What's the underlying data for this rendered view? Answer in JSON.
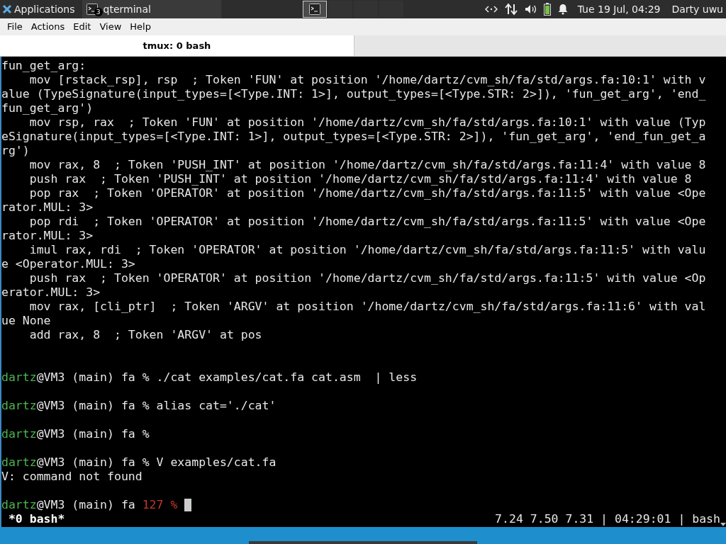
{
  "panel": {
    "apps_label": "Applications",
    "task": {
      "label": "qterminal",
      "badge": "3"
    },
    "clock": "Tue 19 Jul, 04:29",
    "user": "Darty uwu"
  },
  "menu": [
    {
      "label": "File"
    },
    {
      "label": "Actions"
    },
    {
      "label": "Edit"
    },
    {
      "label": "View"
    },
    {
      "label": "Help"
    }
  ],
  "tabs": [
    {
      "label": "tmux: 0 bash",
      "selected": true
    }
  ],
  "terminal": {
    "lines": [
      {
        "kind": "output",
        "text": "fun_get_arg:"
      },
      {
        "kind": "output",
        "text": "    mov [rstack_rsp], rsp  ; Token 'FUN' at position '/home/dartz/cvm_sh/fa/std/args.fa:10:1' with v"
      },
      {
        "kind": "output",
        "text": "alue (TypeSignature(input_types=[<Type.INT: 1>], output_types=[<Type.STR: 2>]), 'fun_get_arg', 'end_"
      },
      {
        "kind": "output",
        "text": "fun_get_arg')"
      },
      {
        "kind": "output",
        "text": "    mov rsp, rax  ; Token 'FUN' at position '/home/dartz/cvm_sh/fa/std/args.fa:10:1' with value (Typ"
      },
      {
        "kind": "output",
        "text": "eSignature(input_types=[<Type.INT: 1>], output_types=[<Type.STR: 2>]), 'fun_get_arg', 'end_fun_get_a"
      },
      {
        "kind": "output",
        "text": "rg')"
      },
      {
        "kind": "output",
        "text": "    mov rax, 8  ; Token 'PUSH_INT' at position '/home/dartz/cvm_sh/fa/std/args.fa:11:4' with value 8"
      },
      {
        "kind": "output",
        "text": "    push rax  ; Token 'PUSH_INT' at position '/home/dartz/cvm_sh/fa/std/args.fa:11:4' with value 8"
      },
      {
        "kind": "output",
        "text": "    pop rax  ; Token 'OPERATOR' at position '/home/dartz/cvm_sh/fa/std/args.fa:11:5' with value <Ope"
      },
      {
        "kind": "output",
        "text": "rator.MUL: 3>"
      },
      {
        "kind": "output",
        "text": "    pop rdi  ; Token 'OPERATOR' at position '/home/dartz/cvm_sh/fa/std/args.fa:11:5' with value <Ope"
      },
      {
        "kind": "output",
        "text": "rator.MUL: 3>"
      },
      {
        "kind": "output",
        "text": "    imul rax, rdi  ; Token 'OPERATOR' at position '/home/dartz/cvm_sh/fa/std/args.fa:11:5' with valu"
      },
      {
        "kind": "output",
        "text": "e <Operator.MUL: 3>"
      },
      {
        "kind": "output",
        "text": "    push rax  ; Token 'OPERATOR' at position '/home/dartz/cvm_sh/fa/std/args.fa:11:5' with value <Op"
      },
      {
        "kind": "output",
        "text": "erator.MUL: 3>"
      },
      {
        "kind": "output",
        "text": "    mov rax, [cli_ptr]  ; Token 'ARGV' at position '/home/dartz/cvm_sh/fa/std/args.fa:11:6' with val"
      },
      {
        "kind": "output",
        "text": "ue None"
      },
      {
        "kind": "output",
        "text": "    add rax, 8  ; Token 'ARGV' at pos"
      },
      {
        "kind": "blank"
      },
      {
        "kind": "blank"
      },
      {
        "kind": "prompt",
        "user": "dartz",
        "host": "@VM3 (main) fa",
        "symbol": "%",
        "command": "./cat examples/cat.fa cat.asm  | less"
      },
      {
        "kind": "blank"
      },
      {
        "kind": "prompt",
        "user": "dartz",
        "host": "@VM3 (main) fa",
        "symbol": "%",
        "command": "alias cat='./cat'"
      },
      {
        "kind": "blank"
      },
      {
        "kind": "prompt",
        "user": "dartz",
        "host": "@VM3 (main) fa",
        "symbol": "%"
      },
      {
        "kind": "blank"
      },
      {
        "kind": "prompt",
        "user": "dartz",
        "host": "@VM3 (main) fa",
        "symbol": "%",
        "command": "V examples/cat.fa"
      },
      {
        "kind": "output",
        "text": "V: command not found"
      },
      {
        "kind": "blank"
      },
      {
        "kind": "prompt",
        "user": "dartz",
        "host": "@VM3 (main) fa",
        "status": "127",
        "symbol": "%",
        "cursor": true
      }
    ],
    "status_left": "*0 bash*",
    "status_right": "7.24 7.50 7.31 | 04:29:01 | bash"
  }
}
